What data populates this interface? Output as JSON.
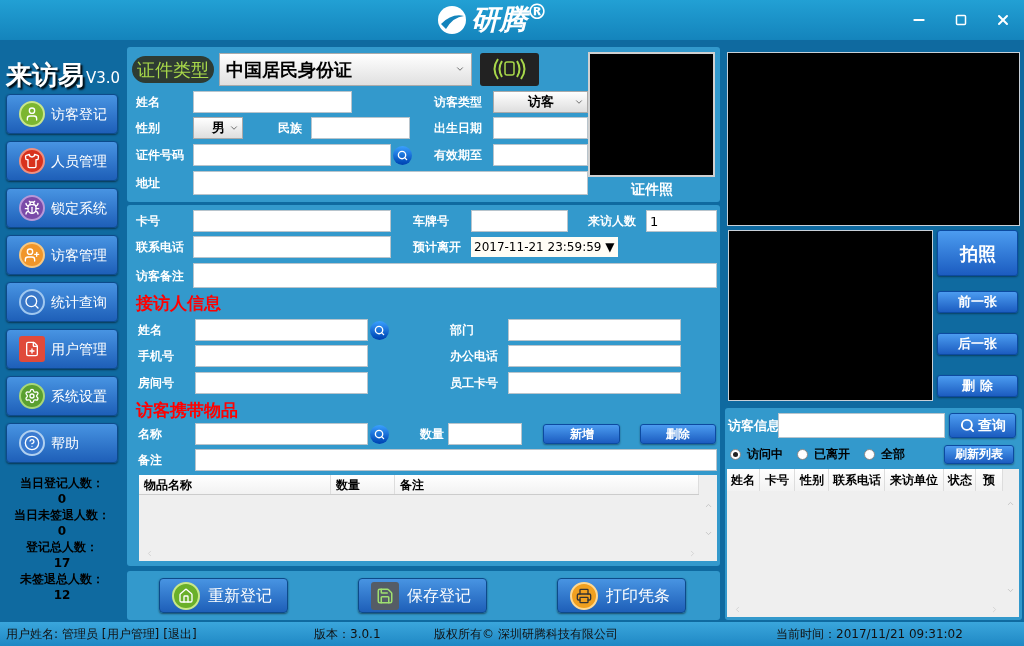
{
  "window": {
    "logo": "研腾$^{®}$"
  },
  "app": {
    "name": "来访易",
    "version": "V3.0"
  },
  "sidebar": {
    "items": [
      {
        "label": "访客登记",
        "kind": "visitor"
      },
      {
        "label": "人员管理",
        "kind": "staff"
      },
      {
        "label": "锁定系统",
        "kind": "lock"
      },
      {
        "label": "访客管理",
        "kind": "visitor_manage"
      },
      {
        "label": "统计查询",
        "kind": "stats"
      },
      {
        "label": "用户管理",
        "kind": "user_manage"
      },
      {
        "label": "系统设置",
        "kind": "settings"
      },
      {
        "label": "帮助",
        "kind": "help"
      }
    ]
  },
  "stats": [
    {
      "label": "当日登记人数：",
      "value": "0"
    },
    {
      "label": "当日未签退人数：",
      "value": "0"
    },
    {
      "label": "登记总人数：",
      "value": "17"
    },
    {
      "label": "未签退总人数：",
      "value": "12"
    }
  ],
  "id_panel": {
    "type_label": "证件类型",
    "type_value": "中国居民身份证",
    "name_label": "姓名",
    "visitor_type_label": "访客类型",
    "visitor_type_value": "访客",
    "gender_label": "性别",
    "gender_value": "男",
    "ethnicity_label": "民族",
    "birth_label": "出生日期",
    "id_no_label": "证件号码",
    "expiry_label": "有效期至",
    "address_label": "地址",
    "photo_label": "证件照"
  },
  "visit_panel": {
    "card_label": "卡号",
    "plate_label": "车牌号",
    "count_label": "来访人数",
    "count_value": "1",
    "phone_label": "联系电话",
    "leave_label": "预计离开",
    "leave_value": "2017-11-21 23:59:59 ▼",
    "remark_label": "访客备注"
  },
  "host": {
    "title": "接访人信息",
    "name_label": "姓名",
    "dept_label": "部门",
    "mobile_label": "手机号",
    "office_phone_label": "办公电话",
    "room_label": "房间号",
    "staff_card_label": "员工卡号"
  },
  "items": {
    "title": "访客携带物品",
    "name_label": "名称",
    "qty_label": "数量",
    "add_button": "新增",
    "delete_button": "删除",
    "remark_label": "备注",
    "columns": [
      "物品名称",
      "数量",
      "备注"
    ]
  },
  "actions": [
    {
      "label": "重新登记",
      "kind": "home"
    },
    {
      "label": "保存登记",
      "kind": "save"
    },
    {
      "label": "打印凭条",
      "kind": "print"
    }
  ],
  "camera": {
    "shoot_button": "拍照",
    "prev_button": "前一张",
    "next_button": "后一张",
    "delete_button": "删 除"
  },
  "visitors": {
    "search_label": "访客信息",
    "search_button": "查询",
    "filters": [
      {
        "label": "访问中",
        "selected": true
      },
      {
        "label": "已离开",
        "selected": false
      },
      {
        "label": "全部",
        "selected": false
      }
    ],
    "refresh_button": "刷新列表",
    "columns": [
      "姓名",
      "卡号",
      "性别",
      "联系电话",
      "来访单位",
      "状态",
      "预"
    ]
  },
  "status_bar": {
    "user": "用户姓名: 管理员",
    "links": [
      "[用户管理]",
      "[退出]"
    ],
    "version": "版本：3.0.1",
    "copyright": "版权所有© 深圳研腾科技有限公司",
    "time": "当前时间：2017/11/21 09:31:02"
  }
}
